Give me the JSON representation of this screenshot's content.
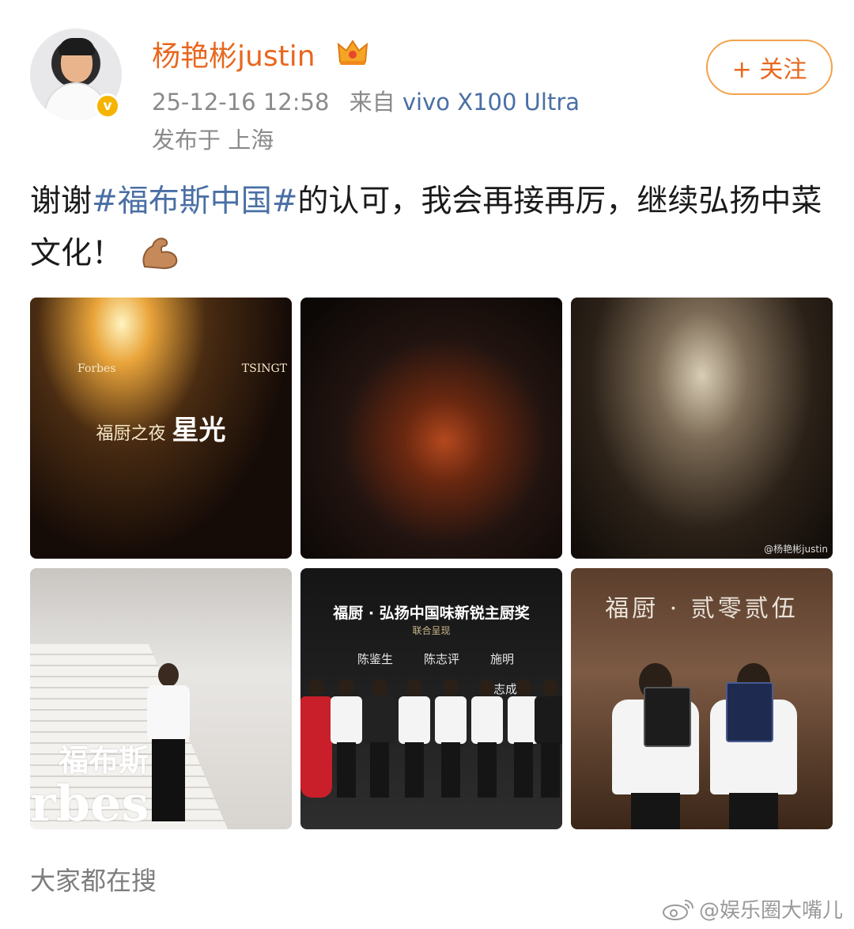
{
  "header": {
    "username": "杨艳彬justin",
    "timestamp": "25-12-16 12:58",
    "source_prefix": "来自",
    "device": "vivo X100 Ultra",
    "location": "发布于 上海",
    "follow_label": "+ 关注"
  },
  "post": {
    "text_before": "谢谢",
    "hashtag": "#福布斯中国#",
    "text_after": "的认可，我会再接再厉，继续弘扬中菜文化！"
  },
  "images": {
    "image1": {
      "logo_left": "Forbes",
      "logo_right": "TSINGT",
      "caption_cn": "福厨之夜",
      "caption_big": "星光"
    },
    "image4": {
      "word_cn": "福布斯",
      "word_en": "rbes"
    },
    "image5": {
      "title": "福厨 · 弘扬中国味新锐主厨奖",
      "sub": "联合呈现",
      "names": [
        "陈鉴生",
        "陈志评",
        "施明",
        "志成"
      ]
    },
    "image6": {
      "title": "福厨 · 贰零贰伍"
    },
    "watermark3": "@杨艳彬justin"
  },
  "footer": {
    "search_label": "大家都在搜",
    "watermark": "@娱乐圈大嘴儿"
  }
}
